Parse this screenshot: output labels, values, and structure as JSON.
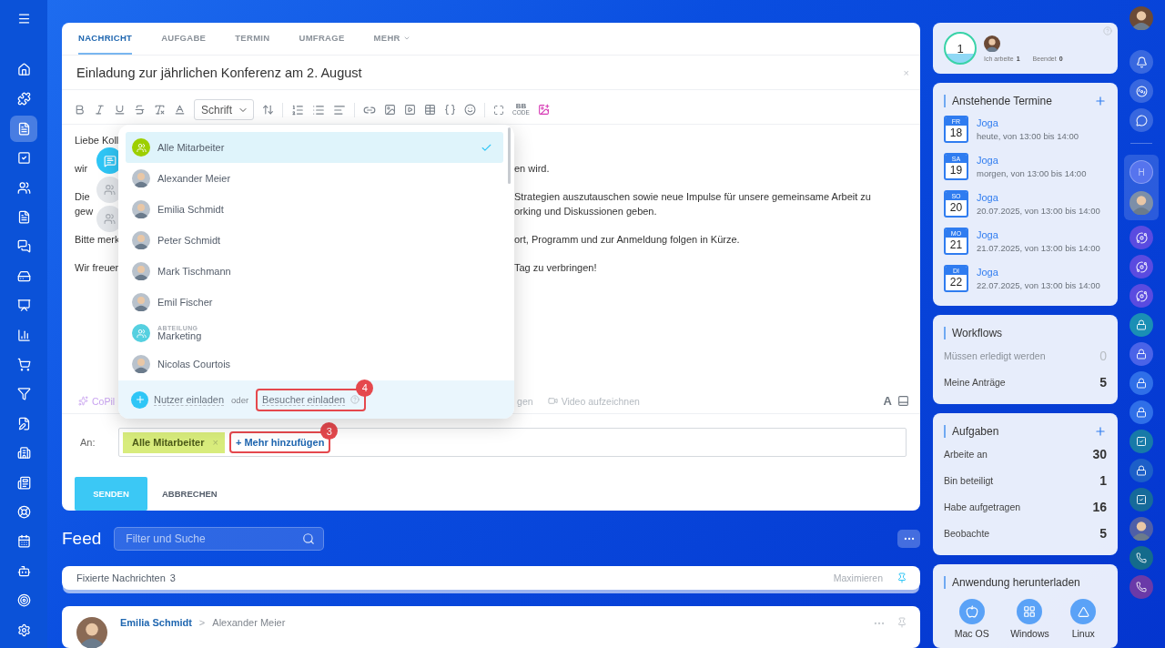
{
  "editor": {
    "tabs": [
      {
        "label": "NACHRICHT",
        "selected": true
      },
      {
        "label": "AUFGABE",
        "selected": false
      },
      {
        "label": "TERMIN",
        "selected": false
      },
      {
        "label": "UMFRAGE",
        "selected": false
      },
      {
        "label": "MEHR",
        "selected": false,
        "dropdown": true
      }
    ],
    "subject": "Einladung zur jährlichen Konferenz am 2. August",
    "subject_close": "×",
    "toolbar": {
      "font_select": "Schrift",
      "bb_label": "BB",
      "bb_sub": "CODE"
    },
    "body": [
      {
        "lines": [
          {
            "left": "Liebe Koll"
          }
        ]
      },
      {
        "lines": [
          {
            "left": "wir",
            "right": "en wird."
          }
        ]
      },
      {
        "lines": [
          {
            "left": "Die",
            "right": "Strategien auszutauschen sowie neue Impulse für unsere gemeinsame Arbeit zu"
          },
          {
            "left": "gew",
            "right": "orking und Diskussionen geben."
          }
        ]
      },
      {
        "lines": [
          {
            "left": "Bitte merk",
            "right": "ort, Programm und zur Anmeldung folgen in Kürze."
          }
        ]
      },
      {
        "lines": [
          {
            "left": "Wir freuer",
            "right": "Tag zu verbringen!"
          }
        ]
      }
    ],
    "footer": {
      "copilot": "CoPil",
      "partial": "gen",
      "video": "Video aufzeichnen",
      "font_toggle": "A"
    },
    "recipients": {
      "label": "An:",
      "chips": [
        "Alle Mitarbeiter"
      ],
      "chip_remove": "×",
      "add_link": "+ Mehr hinzufügen",
      "add_badge": "3"
    },
    "buttons": {
      "send": "SENDEN",
      "cancel": "ABBRECHEN"
    }
  },
  "dropdown": {
    "items": [
      {
        "kind": "group",
        "name": "Alle Mitarbeiter",
        "selected": true
      },
      {
        "kind": "person",
        "name": "Alexander Meier",
        "selected": false
      },
      {
        "kind": "person",
        "name": "Emilia Schmidt",
        "selected": false
      },
      {
        "kind": "person",
        "name": "Peter Schmidt",
        "selected": false
      },
      {
        "kind": "person",
        "name": "Mark Tischmann",
        "selected": false
      },
      {
        "kind": "person",
        "name": "Emil Fischer",
        "selected": false
      },
      {
        "kind": "department",
        "caption": "ABTEILUNG",
        "name": "Marketing",
        "selected": false
      },
      {
        "kind": "person",
        "name": "Nicolas Courtois",
        "selected": false
      }
    ],
    "footer": {
      "invite_users": "Nutzer einladen",
      "or": "oder",
      "invite_guests": "Besucher einladen",
      "badge": "4"
    }
  },
  "feed": {
    "title": "Feed",
    "search": {
      "placeholder": "Filter und Suche"
    },
    "pinned": {
      "label": "Fixierte Nachrichten",
      "count": "3",
      "action": "Maximieren"
    },
    "post": {
      "author": "Emilia Schmidt",
      "separator": ">",
      "recipient": "Alexander Meier"
    }
  },
  "widgets": {
    "status": {
      "counter": "1",
      "working_label": "Ich arbeite",
      "working": "1",
      "done_label": "Beendet",
      "done": "0"
    },
    "events": {
      "title": "Anstehende Termine",
      "items": [
        {
          "weekday": "FR",
          "day": "18",
          "title": "Joga",
          "time": "heute, von 13:00 bis 14:00"
        },
        {
          "weekday": "SA",
          "day": "19",
          "title": "Joga",
          "time": "morgen, von 13:00 bis 14:00"
        },
        {
          "weekday": "SO",
          "day": "20",
          "title": "Joga",
          "time": "20.07.2025, von 13:00 bis 14:00"
        },
        {
          "weekday": "MO",
          "day": "21",
          "title": "Joga",
          "time": "21.07.2025, von 13:00 bis 14:00"
        },
        {
          "weekday": "DI",
          "day": "22",
          "title": "Joga",
          "time": "22.07.2025, von 13:00 bis 14:00"
        }
      ]
    },
    "workflows": {
      "title": "Workflows",
      "rows": [
        {
          "label": "Müssen erledigt werden",
          "value": "0",
          "disabled": true
        },
        {
          "label": "Meine Anträge",
          "value": "5",
          "disabled": false
        }
      ]
    },
    "tasks": {
      "title": "Aufgaben",
      "rows": [
        {
          "label": "Arbeite an",
          "value": "30"
        },
        {
          "label": "Bin beteiligt",
          "value": "1"
        },
        {
          "label": "Habe aufgetragen",
          "value": "16"
        },
        {
          "label": "Beobachte",
          "value": "5"
        }
      ]
    },
    "download": {
      "title": "Anwendung herunterladen",
      "apps": [
        {
          "kind": "mac",
          "label": "Mac OS"
        },
        {
          "kind": "windows",
          "label": "Windows"
        },
        {
          "kind": "linux",
          "label": "Linux"
        }
      ]
    }
  },
  "right_bar": {
    "group_initial": "H"
  }
}
